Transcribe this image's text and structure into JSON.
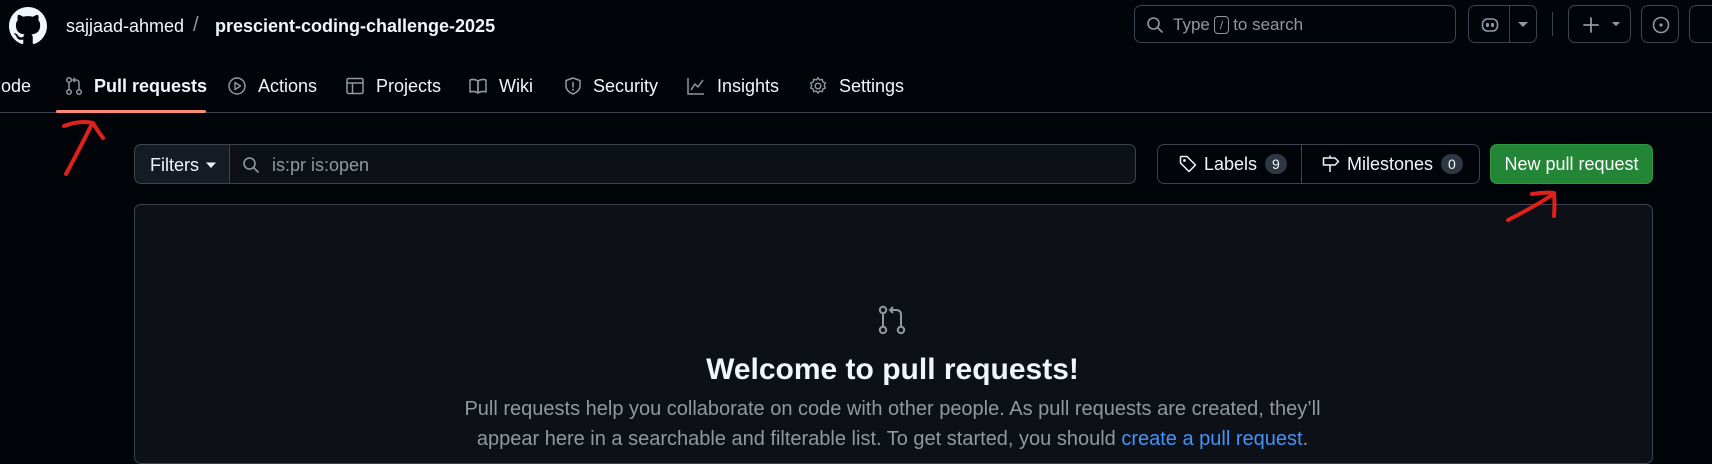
{
  "header": {
    "owner": "sajjaad-ahmed",
    "separator": "/",
    "repo": "prescient-coding-challenge-2025",
    "search": {
      "before": "Type",
      "key": "/",
      "after": "to search"
    }
  },
  "nav": {
    "tabs": [
      {
        "label": "Code",
        "icon": "code-icon"
      },
      {
        "label": "Pull requests",
        "icon": "git-pull-request-icon",
        "active": true
      },
      {
        "label": "Actions",
        "icon": "play-icon"
      },
      {
        "label": "Projects",
        "icon": "table-icon"
      },
      {
        "label": "Wiki",
        "icon": "book-icon"
      },
      {
        "label": "Security",
        "icon": "shield-icon"
      },
      {
        "label": "Insights",
        "icon": "graph-icon"
      },
      {
        "label": "Settings",
        "icon": "gear-icon"
      }
    ]
  },
  "toolbar": {
    "filters_label": "Filters",
    "search_value": "is:pr is:open",
    "labels": {
      "label": "Labels",
      "count": "9"
    },
    "milestones": {
      "label": "Milestones",
      "count": "0"
    },
    "new_pr_label": "New pull request"
  },
  "empty_state": {
    "title": "Welcome to pull requests!",
    "line1": "Pull requests help you collaborate on code with other people. As pull requests are created, they’ll",
    "line2_text": "appear here in a searchable and filterable list. To get started, you should ",
    "line2_link": "create a pull request",
    "line2_end": "."
  },
  "colors": {
    "background": "#010409",
    "accent_underline": "#fd8c73",
    "primary_button": "#238636",
    "link": "#4493f8",
    "annotation": "#e0201b"
  }
}
